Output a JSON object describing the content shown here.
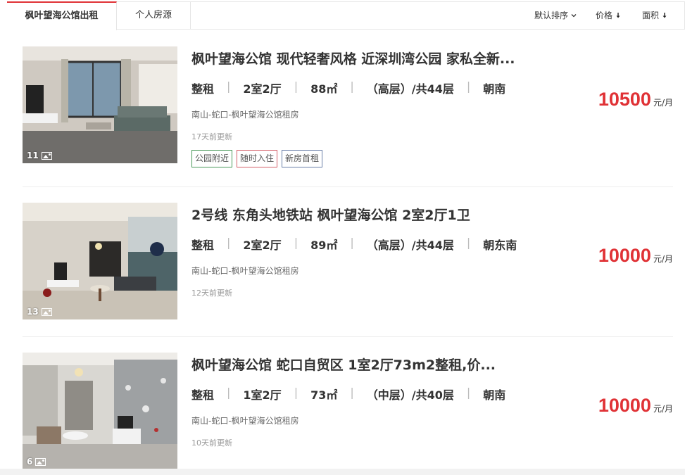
{
  "tabs": [
    {
      "label": "枫叶望海公馆出租"
    },
    {
      "label": "个人房源"
    }
  ],
  "sort": [
    {
      "label": "默认排序",
      "icon": "chevron-down-icon"
    },
    {
      "label": "价格",
      "icon": "arrow-down-icon"
    },
    {
      "label": "面积",
      "icon": "arrow-down-icon"
    }
  ],
  "listings": [
    {
      "title": "枫叶望海公馆 现代轻奢风格 近深圳湾公园 家私全新...",
      "rent_type": "整租",
      "layout": "2室2厅",
      "area": "88㎡",
      "floor": "（高层）/共44层",
      "orientation": "朝南",
      "address": "南山-蛇口-枫叶望海公馆租房",
      "updated": "17天前更新",
      "photo_count": "11",
      "price": "10500",
      "price_unit": "元/月",
      "tags": [
        "公园附近",
        "随时入住",
        "新房首租"
      ]
    },
    {
      "title": "2号线 东角头地铁站 枫叶望海公馆 2室2厅1卫",
      "rent_type": "整租",
      "layout": "2室2厅",
      "area": "89㎡",
      "floor": "（高层）/共44层",
      "orientation": "朝东南",
      "address": "南山-蛇口-枫叶望海公馆租房",
      "updated": "12天前更新",
      "photo_count": "13",
      "price": "10000",
      "price_unit": "元/月",
      "tags": []
    },
    {
      "title": "枫叶望海公馆 蛇口自贸区 1室2厅73m2整租,价...",
      "rent_type": "整租",
      "layout": "1室2厅",
      "area": "73㎡",
      "floor": "（中层）/共40层",
      "orientation": "朝南",
      "address": "南山-蛇口-枫叶望海公馆租房",
      "updated": "10天前更新",
      "photo_count": "6",
      "price": "10000",
      "price_unit": "元/月",
      "tags": []
    }
  ],
  "colors": {
    "accent": "#e03236",
    "tag_green": "#4a9a5a",
    "tag_red": "#d4606a",
    "tag_blue": "#6a7fa8"
  }
}
